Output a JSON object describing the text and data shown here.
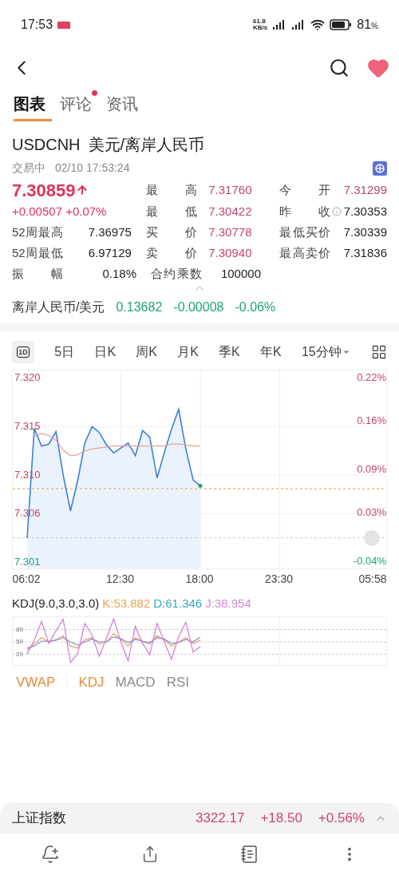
{
  "status_bar": {
    "time": "17:53",
    "net_speed": "61.8",
    "net_unit": "KB/s",
    "battery": "81",
    "battery_unit": "%"
  },
  "tabs": [
    {
      "label": "图表",
      "selected": true
    },
    {
      "label": "评论",
      "selected": false,
      "dot": true
    },
    {
      "label": "资讯",
      "selected": false
    }
  ],
  "instrument": {
    "symbol": "USDCNH",
    "name": "美元/离岸人民币",
    "status": "交易中",
    "timestamp": "02/10 17:53:24"
  },
  "quote": {
    "price": "7.30859",
    "change": "+0.00507",
    "change_pct": "+0.07%",
    "color": "#e0335a"
  },
  "stats": [
    [
      {
        "label": "最 高",
        "value": "7.31760",
        "color": "#c2456a"
      },
      {
        "label": "今 开",
        "value": "7.31299",
        "color": "#c2456a"
      }
    ],
    [
      {
        "label": "最 低",
        "value": "7.30422",
        "color": "#c2456a"
      },
      {
        "label": "昨 收",
        "value": "7.30353",
        "color": "#222222",
        "info": true
      }
    ],
    [
      {
        "label": "52周最高",
        "value": "7.36975",
        "color": "#222222"
      },
      {
        "label": "买 价",
        "value": "7.30778",
        "color": "#c2456a"
      },
      {
        "label": "最低买价",
        "value": "7.30339",
        "color": "#222222"
      }
    ],
    [
      {
        "label": "52周最低",
        "value": "6.97129",
        "color": "#222222"
      },
      {
        "label": "卖 价",
        "value": "7.30940",
        "color": "#c2456a"
      },
      {
        "label": "最高卖价",
        "value": "7.31836",
        "color": "#222222"
      }
    ],
    [
      {
        "label": "振 幅",
        "value": "0.18%",
        "color": "#222222"
      },
      {
        "label": "合约乘数",
        "value": "100000",
        "color": "#222222"
      }
    ]
  ],
  "related": {
    "name": "离岸人民币/美元",
    "price": "0.13682",
    "change": "-0.00008",
    "change_pct": "-0.06%",
    "color": "#1fa37a"
  },
  "periods": [
    {
      "label": "1D",
      "kind": "boxed",
      "selected": true
    },
    {
      "label": "5日",
      "kind": "text",
      "selected": false
    },
    {
      "label": "日K",
      "kind": "text",
      "selected": false
    },
    {
      "label": "周K",
      "kind": "text",
      "selected": false
    },
    {
      "label": "月K",
      "kind": "text",
      "selected": false
    },
    {
      "label": "季K",
      "kind": "text",
      "selected": false
    },
    {
      "label": "年K",
      "kind": "text",
      "selected": false
    },
    {
      "label": "15分钟",
      "kind": "dropdown",
      "selected": false
    }
  ],
  "chart": {
    "chart_data": {
      "type": "line",
      "grid": true,
      "ylim": [
        7.3002,
        7.3208
      ],
      "y2lim": [
        -0.0513,
        0.2313
      ],
      "categories": [
        "06:02",
        null,
        null,
        null,
        null,
        null,
        null,
        null,
        null,
        null,
        null,
        null,
        null,
        "12:30",
        null,
        null,
        null,
        null,
        null,
        null,
        null,
        null,
        null,
        null,
        "18:00",
        null,
        null,
        null,
        null,
        null,
        null,
        null,
        null,
        null,
        null,
        "23:30",
        null,
        null,
        null,
        null,
        null,
        null,
        null,
        null,
        null,
        null,
        null,
        null,
        "05:58"
      ],
      "yticks": [
        {
          "value": 7.32,
          "label": "7.320"
        },
        {
          "value": 7.315,
          "label": "7.315"
        },
        {
          "value": 7.31,
          "label": "7.310"
        },
        {
          "value": 7.306,
          "label": "7.306"
        },
        {
          "value": 7.301,
          "label": "7.301"
        }
      ],
      "y2ticks": [
        {
          "value": 0.22,
          "label": "0.22%"
        },
        {
          "value": 0.16,
          "label": "0.16%"
        },
        {
          "value": 0.09,
          "label": "0.09%"
        },
        {
          "value": 0.03,
          "label": "0.03%"
        },
        {
          "value": -0.04,
          "label": "-0.04%"
        }
      ],
      "series": [
        {
          "color": "#3b7fd9",
          "values": [
            7.3035,
            7.3148,
            7.313,
            7.3132,
            7.3145,
            7.31,
            7.3063,
            7.3094,
            7.3133,
            7.315,
            7.3144,
            7.3131,
            7.3123,
            7.3128,
            7.3133,
            7.312,
            7.3146,
            7.3139,
            7.3097,
            7.3123,
            7.3147,
            7.3168,
            7.3127,
            7.3095,
            7.3089,
            null,
            null,
            null,
            null,
            null,
            null,
            null,
            null,
            null,
            null,
            null,
            null,
            null,
            null,
            null,
            null,
            null,
            null,
            null,
            null,
            null,
            null,
            null,
            null
          ]
        },
        {
          "color": "#e2a58f",
          "values": [
            null,
            7.314,
            7.3143,
            7.3141,
            7.3136,
            7.3126,
            7.312,
            7.3121,
            7.3125,
            7.3127,
            7.3128,
            7.3129,
            7.313,
            7.313,
            7.313,
            7.313,
            7.313,
            7.313,
            7.313,
            7.313,
            7.3132,
            7.3132,
            7.3131,
            7.313,
            7.313,
            null,
            null,
            null,
            null,
            null,
            null,
            null,
            null,
            null,
            null,
            null,
            null,
            null,
            null,
            null,
            null,
            null,
            null,
            null,
            null,
            null,
            null,
            null,
            null
          ]
        }
      ],
      "ref_lines": [
        {
          "axis": "y",
          "value": 7.30353,
          "color": "#c8c8c8"
        },
        {
          "axis": "y",
          "value": 7.30859,
          "color": "#e0a030"
        }
      ]
    }
  },
  "kdj": {
    "title": "KDJ(9.0,3.0,3.0)",
    "values": [
      {
        "text": "K:53.882",
        "color": "#e8a45a"
      },
      {
        "text": "D:61.346",
        "color": "#3aa6c9"
      },
      {
        "text": "J:38.954",
        "color": "#d18ad6"
      }
    ],
    "chart_data": {
      "type": "line",
      "grid": true,
      "ylim": [
        -10,
        110
      ],
      "categories": [
        null,
        null,
        null,
        null,
        null,
        null,
        null,
        null,
        null,
        null,
        null,
        null,
        null,
        null,
        null,
        null,
        null,
        null,
        null,
        null,
        null,
        null,
        null,
        null,
        null,
        null,
        null,
        null,
        null,
        null,
        null,
        null,
        null,
        null,
        null,
        null,
        null,
        null,
        null,
        null,
        null,
        null,
        null,
        null,
        null,
        null,
        null,
        null,
        null
      ],
      "yticks": [
        {
          "value": 80,
          "label": "80"
        },
        {
          "value": 50,
          "label": "50"
        },
        {
          "value": 20,
          "label": "20"
        }
      ],
      "series": [
        {
          "color": "#e8a45a",
          "values": [
            30,
            45,
            60,
            50,
            55,
            65,
            40,
            35,
            55,
            60,
            45,
            50,
            70,
            55,
            40,
            60,
            50,
            45,
            65,
            55,
            40,
            50,
            60,
            45,
            54,
            null,
            null,
            null,
            null,
            null,
            null,
            null,
            null,
            null,
            null,
            null,
            null,
            null,
            null,
            null,
            null,
            null,
            null,
            null,
            null,
            null,
            null,
            null,
            null
          ]
        },
        {
          "color": "#7b8fe0",
          "values": [
            35,
            40,
            52,
            52,
            54,
            60,
            50,
            42,
            50,
            57,
            50,
            50,
            62,
            58,
            48,
            56,
            52,
            48,
            60,
            57,
            46,
            49,
            56,
            50,
            61,
            null,
            null,
            null,
            null,
            null,
            null,
            null,
            null,
            null,
            null,
            null,
            null,
            null,
            null,
            null,
            null,
            null,
            null,
            null,
            null,
            null,
            null,
            null,
            null
          ]
        },
        {
          "color": "#d27ad8",
          "values": [
            20,
            55,
            100,
            46,
            77,
            105,
            0,
            21,
            95,
            66,
            15,
            60,
            106,
            49,
            4,
            88,
            46,
            19,
            95,
            51,
            8,
            62,
            98,
            25,
            39,
            null,
            null,
            null,
            null,
            null,
            null,
            null,
            null,
            null,
            null,
            null,
            null,
            null,
            null,
            null,
            null,
            null,
            null,
            null,
            null,
            null,
            null,
            null,
            null
          ]
        }
      ]
    }
  },
  "indicators": [
    {
      "label": "VWAP",
      "selected": true
    },
    {
      "label": "KDJ",
      "selected": true
    },
    {
      "label": "MACD",
      "selected": false
    },
    {
      "label": "RSI",
      "selected": false
    }
  ],
  "index_bar": {
    "name": "上证指数",
    "value": "3322.17",
    "change": "+18.50",
    "change_pct": "+0.56%",
    "color": "#d0456a"
  }
}
